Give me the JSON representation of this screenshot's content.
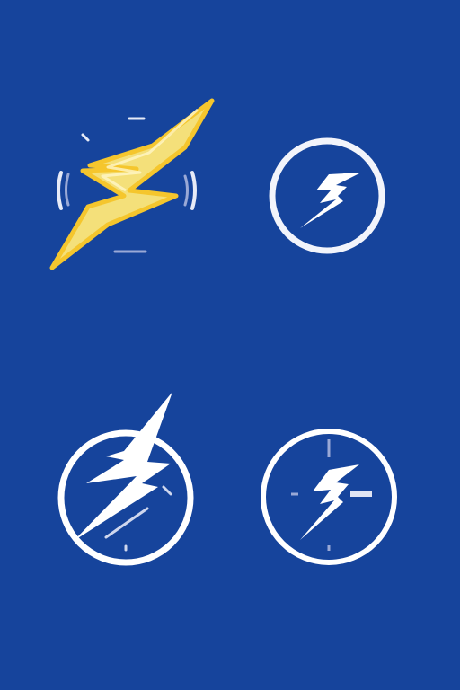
{
  "colors": {
    "background": "#16449c",
    "bolt_fill": "#f4e07a",
    "bolt_outline": "#f5c62d",
    "icon_white": "#ffffff",
    "tick_gray": "#9aa9d6"
  },
  "icons": [
    {
      "name": "yellow-lightning-bolt-icon"
    },
    {
      "name": "circle-bolt-icon"
    },
    {
      "name": "circle-large-bolt-icon"
    },
    {
      "name": "circle-crosshair-bolt-icon"
    }
  ]
}
